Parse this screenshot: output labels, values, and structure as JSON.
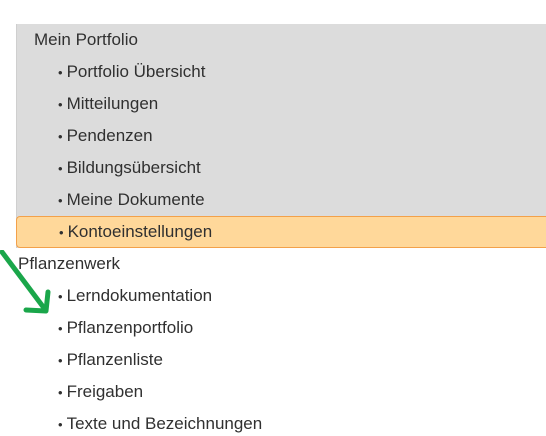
{
  "menu": {
    "sections": [
      {
        "title": "Mein Portfolio",
        "items": [
          {
            "label": "Portfolio Übersicht"
          },
          {
            "label": "Mitteilungen"
          },
          {
            "label": "Pendenzen"
          },
          {
            "label": "Bildungsübersicht"
          },
          {
            "label": "Meine Dokumente"
          },
          {
            "label": "Kontoeinstellungen",
            "active": true
          }
        ]
      },
      {
        "title": "Pflanzenwerk",
        "items": [
          {
            "label": "Lerndokumentation"
          },
          {
            "label": "Pflanzenportfolio"
          },
          {
            "label": "Pflanzenliste"
          },
          {
            "label": "Freigaben"
          },
          {
            "label": "Texte und Bezeichnungen"
          }
        ]
      }
    ]
  },
  "bullet_char": "•",
  "colors": {
    "section_bg": "#dcdcdc",
    "active_bg": "#ffd89a",
    "active_border": "#f3a14a",
    "arrow": "#1aa64a",
    "text": "#303030"
  },
  "annotation": {
    "arrow_icon": "green-arrow-icon"
  }
}
